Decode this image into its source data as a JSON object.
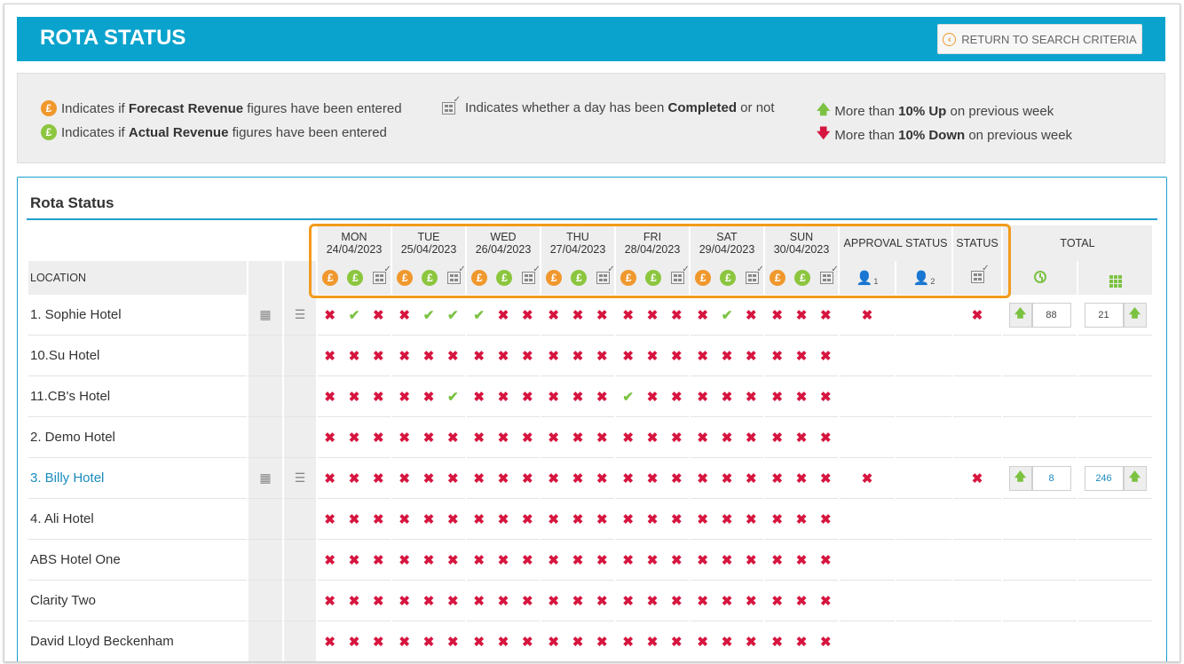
{
  "header": {
    "title": "ROTA STATUS",
    "return_label": "RETURN TO SEARCH CRITERIA"
  },
  "legend": {
    "forecast": {
      "prefix": "Indicates if ",
      "bold": "Forecast Revenue",
      "suffix": " figures have been entered"
    },
    "actual": {
      "prefix": "Indicates if ",
      "bold": "Actual Revenue",
      "suffix": " figures have been entered"
    },
    "completed": {
      "prefix": "Indicates whether a day has been ",
      "bold": "Completed",
      "suffix": " or not"
    },
    "up": {
      "prefix": "More than ",
      "bold": "10% Up",
      "suffix": " on previous week"
    },
    "down": {
      "prefix": "More than ",
      "bold": "10% Down",
      "suffix": " on previous week"
    }
  },
  "panel": {
    "title": "Rota Status"
  },
  "table": {
    "location_header": "LOCATION",
    "approval_header": "APPROVAL STATUS",
    "status_header": "STATUS",
    "total_header": "TOTAL",
    "coin_symbol": "£",
    "days": [
      {
        "day": "MON",
        "date": "24/04/2023"
      },
      {
        "day": "TUE",
        "date": "25/04/2023"
      },
      {
        "day": "WED",
        "date": "26/04/2023"
      },
      {
        "day": "THU",
        "date": "27/04/2023"
      },
      {
        "day": "FRI",
        "date": "28/04/2023"
      },
      {
        "day": "SAT",
        "date": "29/04/2023"
      },
      {
        "day": "SUN",
        "date": "30/04/2023"
      }
    ],
    "rows": [
      {
        "location": "1. Sophie Hotel",
        "link": false,
        "icons": true,
        "marks": "xvxxvvvxxxxxxxxxvxxxx",
        "approval": "x",
        "status": "x",
        "hours": "88",
        "cost": "21"
      },
      {
        "location": "10.Su Hotel",
        "link": false,
        "icons": false,
        "marks": "xxxxxxxxxxxxxxxxxxxxx"
      },
      {
        "location": "11.CB's Hotel",
        "link": false,
        "icons": false,
        "marks": "xxxxxvxxxxxxvxxxxxxxx"
      },
      {
        "location": "2. Demo Hotel",
        "link": false,
        "icons": false,
        "marks": "xxxxxxxxxxxxxxxxxxxxx"
      },
      {
        "location": "3. Billy Hotel",
        "link": true,
        "icons": true,
        "marks": "xxxxxxxxxxxxxxxxxxxxx",
        "approval": "x",
        "status": "x",
        "hours": "8",
        "cost": "246"
      },
      {
        "location": "4. Ali Hotel",
        "link": false,
        "icons": false,
        "marks": "xxxxxxxxxxxxxxxxxxxxx"
      },
      {
        "location": "ABS Hotel One",
        "link": false,
        "icons": false,
        "marks": "xxxxxxxxxxxxxxxxxxxxx"
      },
      {
        "location": "Clarity Two",
        "link": false,
        "icons": false,
        "marks": "xxxxxxxxxxxxxxxxxxxxx"
      },
      {
        "location": "David Lloyd Beckenham",
        "link": false,
        "icons": false,
        "marks": "xxxxxxxxxxxxxxxxxxxxx"
      }
    ]
  },
  "colors": {
    "brand": "#0aa3cd",
    "forecast": "#f0982d",
    "actual": "#8cc63f",
    "cross": "#d6153f",
    "tick": "#7cc242",
    "highlight": "#f29b1d"
  }
}
